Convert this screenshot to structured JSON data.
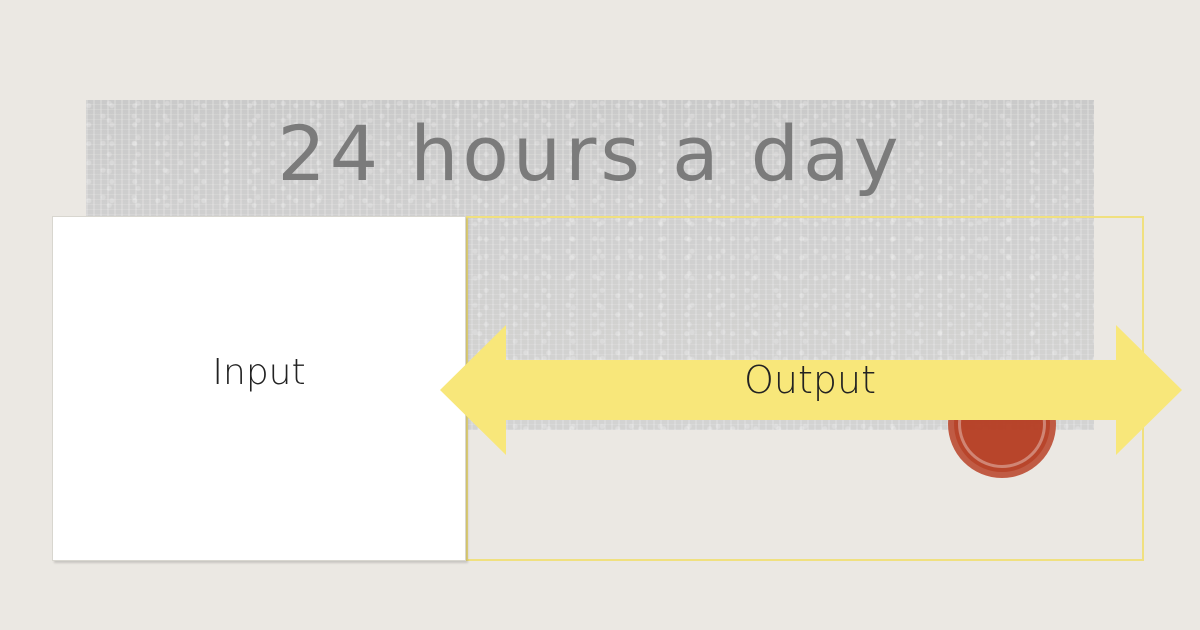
{
  "title": "24 hours a day",
  "input_label": "Input",
  "output_label": "Output",
  "colors": {
    "background": "#ebe8e3",
    "banner_gray": "#cfcfcf",
    "title_text": "#7b7b7b",
    "arrow_fill": "#f8e77a",
    "frame_border": "#f0e07f",
    "accent_red": "#b63d22",
    "label_text": "#222222"
  }
}
